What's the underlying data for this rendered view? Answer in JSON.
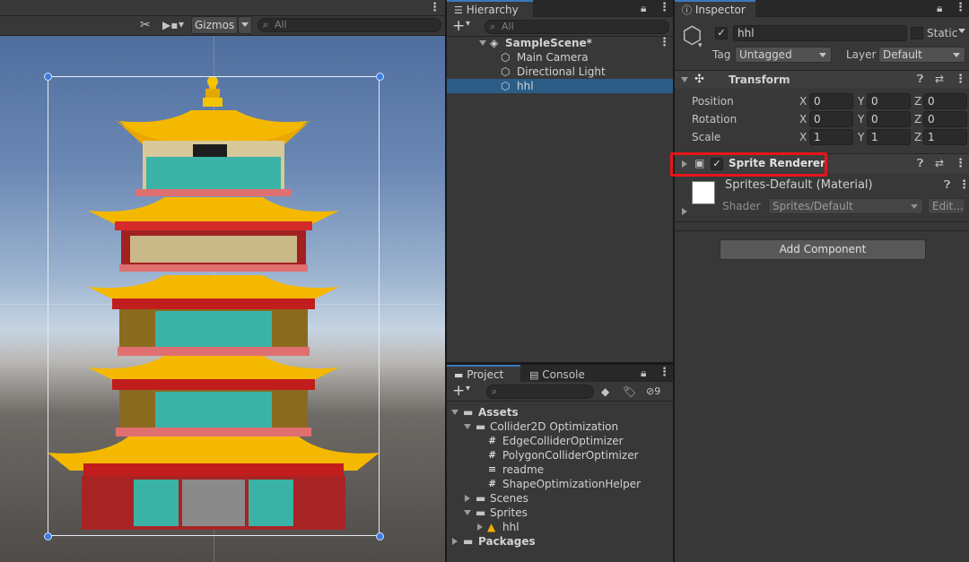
{
  "scene": {
    "gizmos_label": "Gizmos",
    "search_placeholder": "All"
  },
  "hierarchy": {
    "tab_label": "Hierarchy",
    "search_placeholder": "All",
    "items": [
      {
        "label": "SampleScene*"
      },
      {
        "label": "Main Camera"
      },
      {
        "label": "Directional Light"
      },
      {
        "label": "hhl"
      }
    ]
  },
  "project": {
    "tab_label": "Project",
    "console_tab_label": "Console",
    "hidden_count": "9",
    "tree": [
      {
        "label": "Assets"
      },
      {
        "label": "Collider2D Optimization"
      },
      {
        "label": "EdgeColliderOptimizer"
      },
      {
        "label": "PolygonColliderOptimizer"
      },
      {
        "label": "readme"
      },
      {
        "label": "ShapeOptimizationHelper"
      },
      {
        "label": "Scenes"
      },
      {
        "label": "Sprites"
      },
      {
        "label": "hhl"
      },
      {
        "label": "Packages"
      }
    ]
  },
  "inspector": {
    "tab_label": "Inspector",
    "object_name": "hhl",
    "static_label": "Static",
    "tag_label": "Tag",
    "tag_value": "Untagged",
    "layer_label": "Layer",
    "layer_value": "Default",
    "transform": {
      "title": "Transform",
      "position_label": "Position",
      "rotation_label": "Rotation",
      "scale_label": "Scale",
      "position": {
        "x": "0",
        "y": "0",
        "z": "0"
      },
      "rotation": {
        "x": "0",
        "y": "0",
        "z": "0"
      },
      "scale": {
        "x": "1",
        "y": "1",
        "z": "1"
      }
    },
    "sprite_renderer": {
      "title": "Sprite Renderer",
      "material_label": "Sprites-Default (Material)",
      "shader_label": "Shader",
      "shader_value": "Sprites/Default",
      "edit_label": "Edit..."
    },
    "add_component_label": "Add Component",
    "highlight_color": "#e8141c"
  }
}
